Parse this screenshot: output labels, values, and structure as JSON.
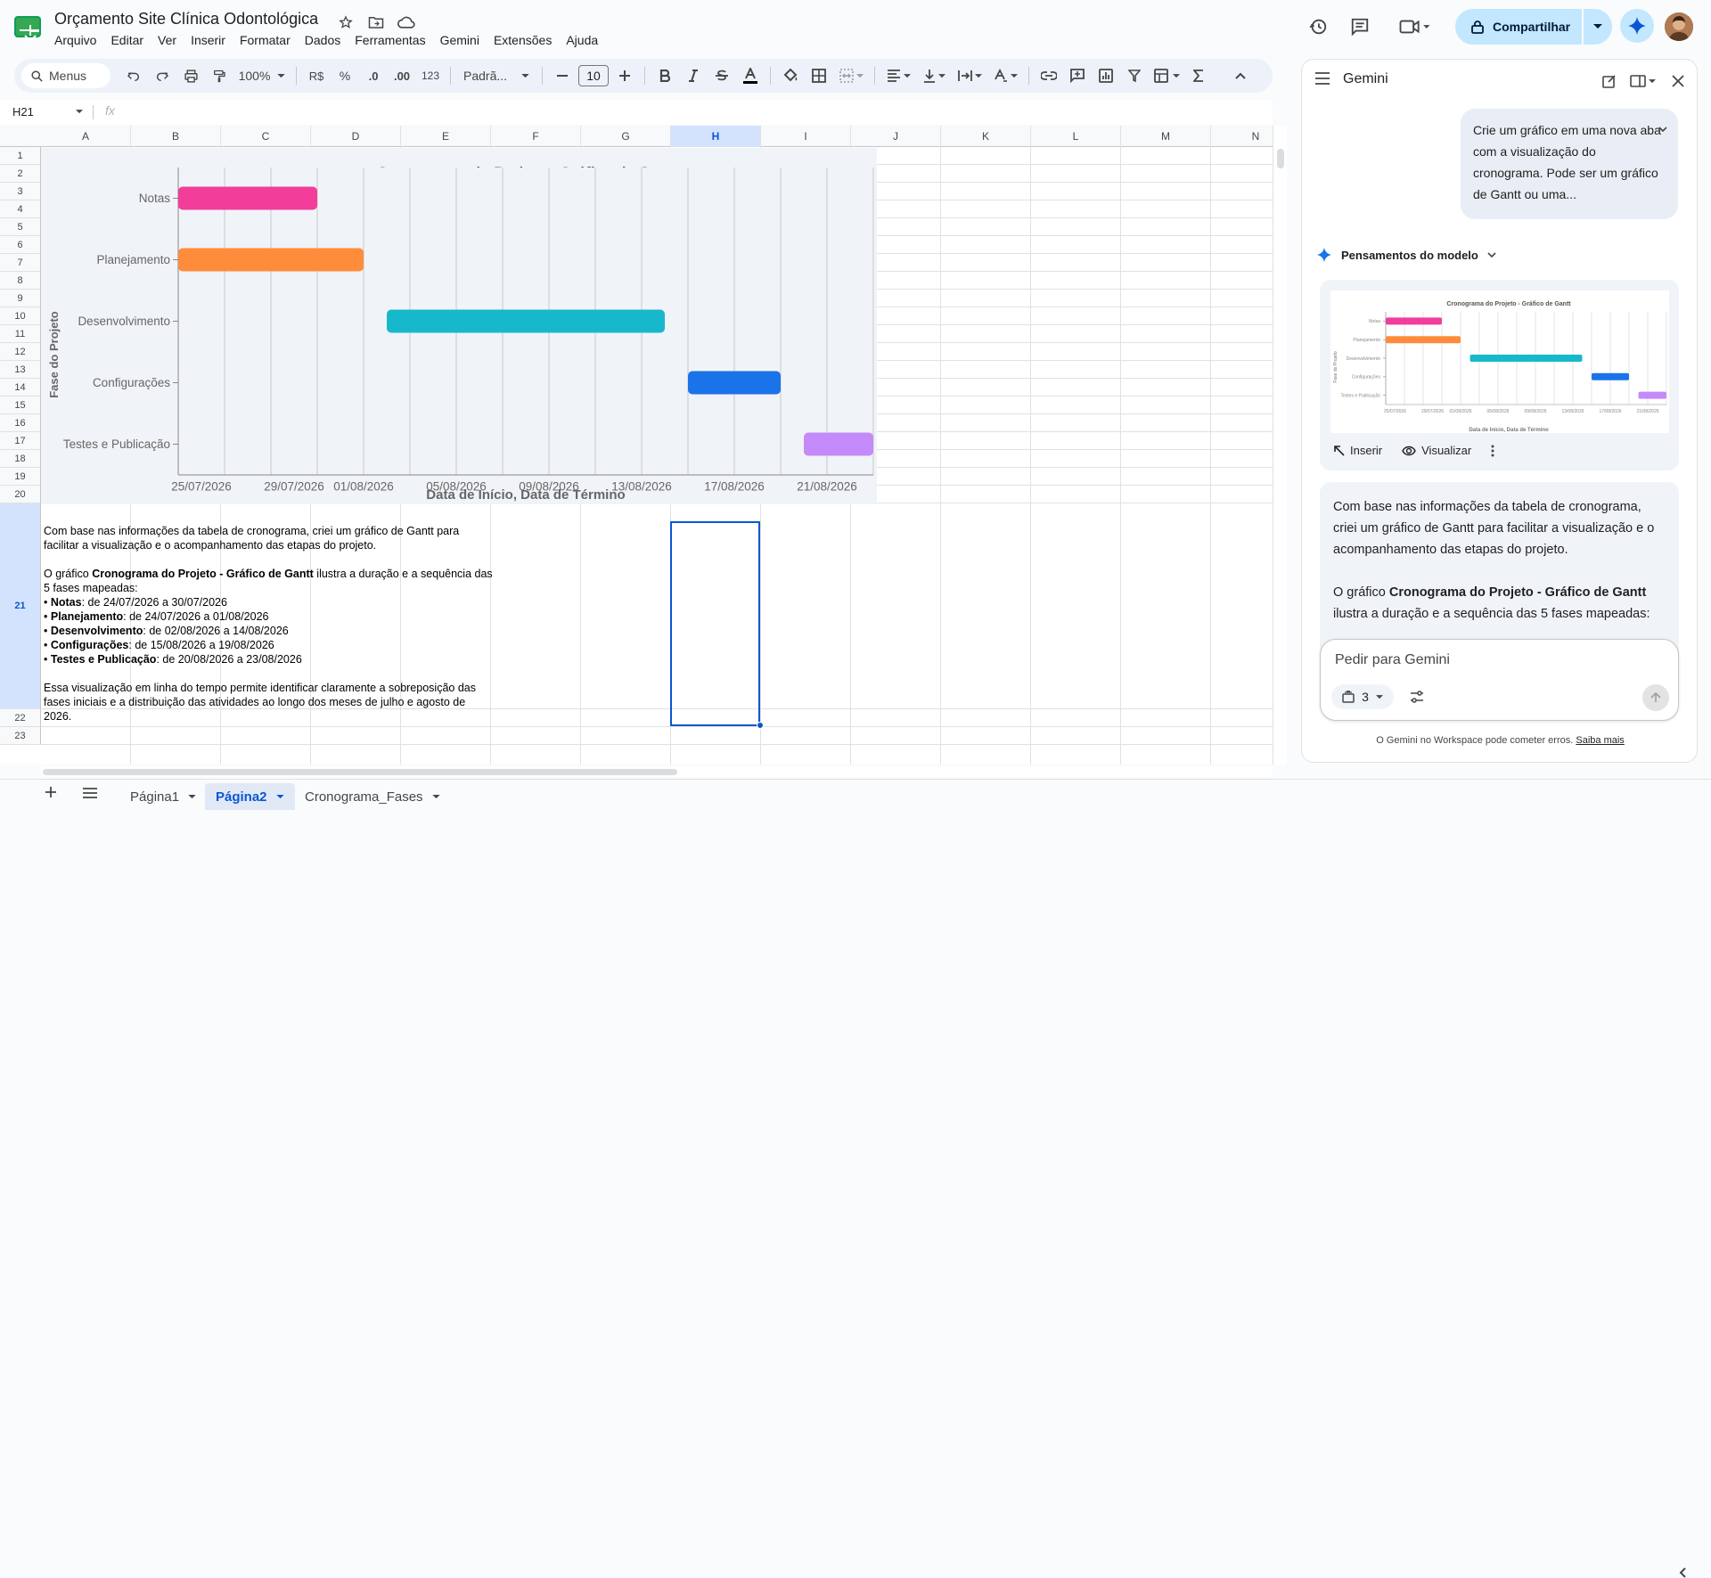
{
  "doc": {
    "title": "Orçamento Site Clínica Odontológica"
  },
  "menu": [
    "Arquivo",
    "Editar",
    "Ver",
    "Inserir",
    "Formatar",
    "Dados",
    "Ferramentas",
    "Gemini",
    "Extensões",
    "Ajuda"
  ],
  "header": {
    "share_label": "Compartilhar"
  },
  "toolbar": {
    "menus": "Menus",
    "zoom": "100%",
    "currency": "R$",
    "percent": "%",
    "dec_minus": ".0",
    "dec_plus": ".00",
    "number_format": "123",
    "font": "Padrã...",
    "font_size": "10"
  },
  "formula": {
    "cell_ref": "H21",
    "fx": "fx"
  },
  "columns": [
    "A",
    "B",
    "C",
    "D",
    "E",
    "F",
    "G",
    "H",
    "I",
    "J",
    "K",
    "L",
    "M",
    "N"
  ],
  "rows": [
    "1",
    "2",
    "3",
    "4",
    "5",
    "6",
    "7",
    "8",
    "9",
    "10",
    "11",
    "12",
    "13",
    "14",
    "15",
    "16",
    "17",
    "18",
    "19",
    "20",
    "21",
    "22",
    "23"
  ],
  "selected": {
    "column": "H",
    "row": "21"
  },
  "cell_a21": {
    "p1": "Com base nas informações da tabela de cronograma, criei um gráfico de Gantt para facilitar a visualização e o acompanhamento das etapas do projeto.",
    "p2_pre": "O gráfico ",
    "p2_bold": "Cronograma do Projeto - Gráfico de Gantt",
    "p2_post": " ilustra a duração e a sequência das 5 fases mapeadas:",
    "items": [
      {
        "bullet": "• ",
        "name": "Notas",
        "range": ": de 24/07/2026 a 30/07/2026"
      },
      {
        "bullet": "• ",
        "name": "Planejamento",
        "range": ": de 24/07/2026 a 01/08/2026"
      },
      {
        "bullet": "• ",
        "name": "Desenvolvimento",
        "range": ": de 02/08/2026 a 14/08/2026"
      },
      {
        "bullet": "• ",
        "name": "Configurações",
        "range": ": de 15/08/2026 a 19/08/2026"
      },
      {
        "bullet": "• ",
        "name": "Testes e Publicação",
        "range": ": de 20/08/2026 a 23/08/2026"
      }
    ],
    "p3": "Essa visualização em linha do tempo permite identificar claramente a sobreposição das fases iniciais e a distribuição das atividades ao longo dos meses de julho e agosto de 2026."
  },
  "chart_data": {
    "type": "gantt",
    "title": "Cronograma do Projeto - Gráfico de Gantt",
    "xlabel": "Data de Início, Data de Término",
    "ylabel": "Fase do Projeto",
    "x_ticks": [
      "25/07/2026",
      "29/07/2026",
      "01/08/2026",
      "05/08/2026",
      "09/08/2026",
      "13/08/2026",
      "17/08/2026",
      "21/08/2026"
    ],
    "xlim": [
      "2026-07-24",
      "2026-08-23"
    ],
    "grid": true,
    "tasks": [
      {
        "name": "Notas",
        "start": "2026-07-24",
        "end": "2026-07-30",
        "color": "#f23d9b"
      },
      {
        "name": "Planejamento",
        "start": "2026-07-24",
        "end": "2026-08-01",
        "color": "#ff8c3b"
      },
      {
        "name": "Desenvolvimento",
        "start": "2026-08-02",
        "end": "2026-08-14",
        "color": "#17b8cc"
      },
      {
        "name": "Configurações",
        "start": "2026-08-15",
        "end": "2026-08-19",
        "color": "#1a73e8"
      },
      {
        "name": "Testes e Publicação",
        "start": "2026-08-20",
        "end": "2026-08-23",
        "color": "#c58af9"
      }
    ]
  },
  "sheets": [
    {
      "name": "Página1",
      "active": false
    },
    {
      "name": "Página2",
      "active": true
    },
    {
      "name": "Cronograma_Fases",
      "active": false
    }
  ],
  "gemini": {
    "title": "Gemini",
    "user_prompt": "Crie um gráfico em uma nova aba com a visualização do cronograma. Pode ser um gráfico de Gantt ou uma...",
    "thinking": "Pensamentos do modelo",
    "insert": "Inserir",
    "preview": "Visualizar",
    "response_p1": "Com base nas informações da tabela de cronograma, criei um gráfico de Gantt para facilitar a visualização e o acompanhamento das etapas do projeto.",
    "response_p2_pre": "O gráfico ",
    "response_p2_bold": "Cronograma do Projeto - Gráfico de Gantt",
    "response_p2_post": " ilustra a duração e a sequência das 5 fases mapeadas:",
    "input_placeholder": "Pedir para Gemini",
    "sources_count": "3",
    "disclaimer": "O Gemini no Workspace pode cometer erros.",
    "learn_more": "Saiba mais"
  }
}
